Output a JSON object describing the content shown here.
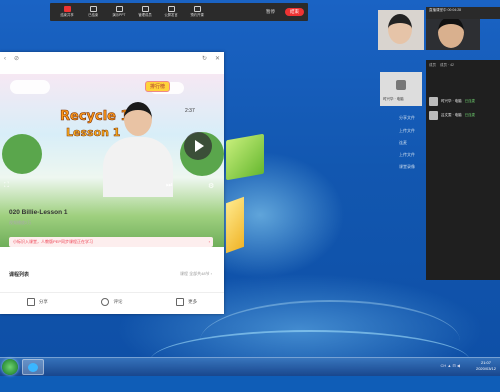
{
  "meeting_bar": {
    "items": [
      "结束共享",
      "已结束",
      "演示PPT",
      "管理成员",
      "公屏发言",
      "预约开课"
    ],
    "pause_label": "暂停",
    "end_label": "结束"
  },
  "phone": {
    "lesson_title": "020 Billie-Lesson 1",
    "lesson_sub": "视频播放2万",
    "notice": "小标识入课堂，人教版PEP同步课程正在学习",
    "notice_arrow": "›",
    "video_title_1": "Recycle 1",
    "video_title_2": "Lesson 1",
    "rank_label": "排行榜",
    "time": "2:37",
    "course_list": "课程列表",
    "course_more": "课程 全部共48节 ›",
    "share_label": "分享",
    "comment_label": "评论",
    "more_label": "更多"
  },
  "cams": {
    "a_name": "",
    "b_name": "本班主讲",
    "card_label": "时兴华 · 电脑"
  },
  "panel": {
    "header_left": "成员",
    "header_count": "成员 · 42",
    "members": [
      {
        "name": "时兴华 · 电脑",
        "status": "已连麦"
      },
      {
        "name": "吕文雯 · 电脑",
        "status": "已连麦"
      }
    ],
    "top_title": "直播课堂中",
    "top_time": "00:04:28"
  },
  "dock_labels": [
    "分享文件",
    "上传文件",
    "连麦",
    "上传文件",
    "课堂录像"
  ],
  "taskbar": {
    "clock_time": "21:07",
    "clock_date": "2020/03/12",
    "tray": "CH  ▲  ⊟  ◀"
  }
}
